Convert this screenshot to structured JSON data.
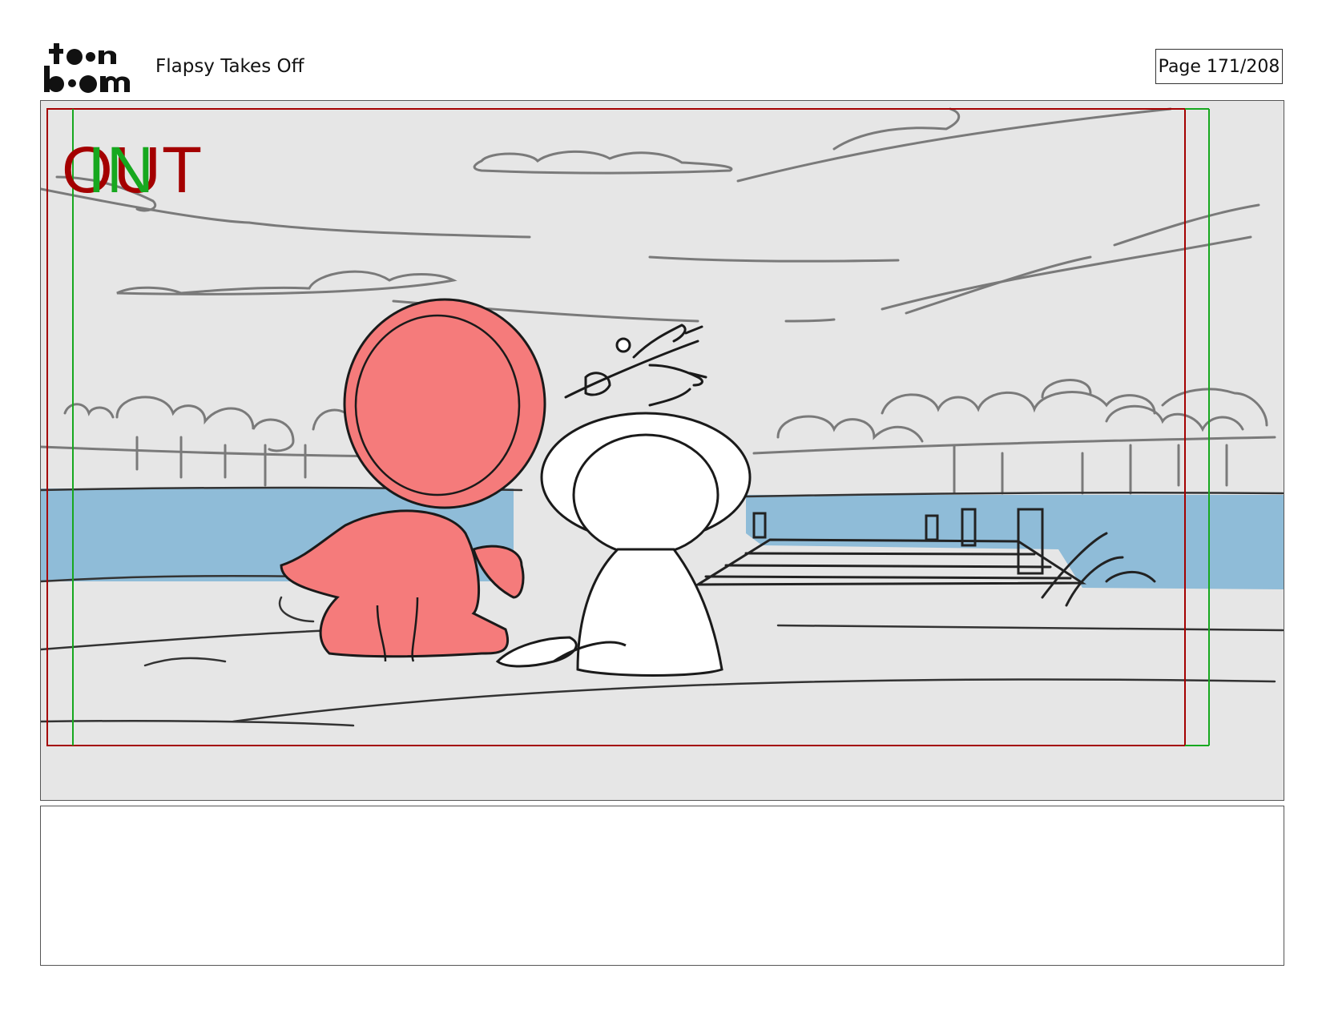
{
  "header": {
    "logo_top": "to•n",
    "logo_bottom": "b••m",
    "project_title": "Flapsy Takes Off",
    "page_label": "Page 171/208"
  },
  "panel": {
    "out_label": "OUT",
    "in_label": "IN",
    "colors": {
      "out_frame": "#a40000",
      "in_frame": "#17a81f",
      "background": "#e6e6e6",
      "water": "#8fbcd8",
      "character_red": "#f57b7b",
      "sketch_line": "#1a1a1a",
      "scenery_line": "#7a7a7a"
    }
  },
  "caption": {
    "text": ""
  }
}
